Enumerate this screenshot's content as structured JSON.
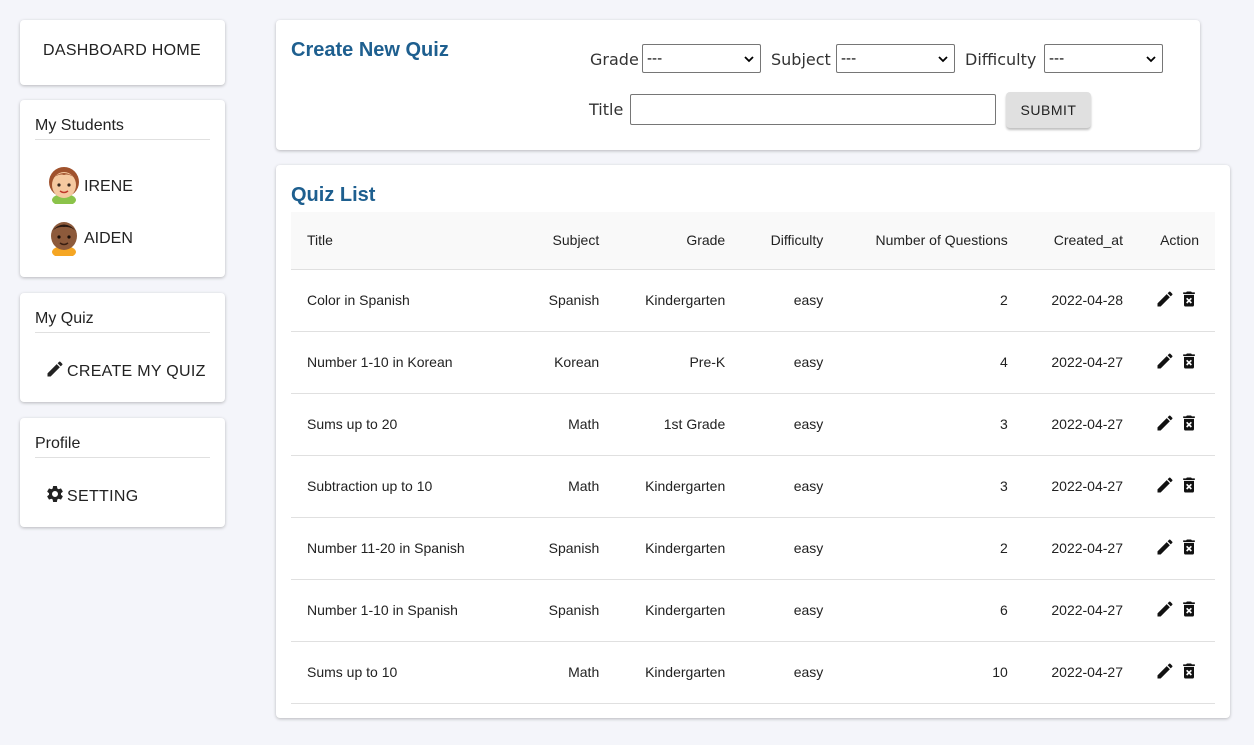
{
  "sidebar": {
    "home_label": "DASHBOARD HOME",
    "students": {
      "heading": "My Students",
      "items": [
        {
          "name": "IRENE",
          "avatar": "girl-avatar"
        },
        {
          "name": "AIDEN",
          "avatar": "boy-avatar"
        }
      ]
    },
    "quiz": {
      "heading": "My Quiz",
      "create_label": "CREATE MY QUIZ",
      "icon": "pencil-icon"
    },
    "profile": {
      "heading": "Profile",
      "setting_label": "SETTING",
      "icon": "gear-icon"
    }
  },
  "create_quiz": {
    "title": "Create New Quiz",
    "grade_label": "Grade",
    "grade_value": "---",
    "subject_label": "Subject",
    "subject_value": "---",
    "difficulty_label": "Difficulty",
    "difficulty_value": "---",
    "title_label": "Title",
    "title_value": "",
    "submit_label": "SUBMIT"
  },
  "quiz_list": {
    "title": "Quiz List",
    "columns": [
      "Title",
      "Subject",
      "Grade",
      "Difficulty",
      "Number of Questions",
      "Created_at",
      "Action"
    ],
    "rows": [
      {
        "title": "Color in Spanish",
        "subject": "Spanish",
        "grade": "Kindergarten",
        "difficulty": "easy",
        "questions": "2",
        "created": "2022-04-28"
      },
      {
        "title": "Number 1-10 in Korean",
        "subject": "Korean",
        "grade": "Pre-K",
        "difficulty": "easy",
        "questions": "4",
        "created": "2022-04-27"
      },
      {
        "title": "Sums up to 20",
        "subject": "Math",
        "grade": "1st Grade",
        "difficulty": "easy",
        "questions": "3",
        "created": "2022-04-27"
      },
      {
        "title": "Subtraction up to 10",
        "subject": "Math",
        "grade": "Kindergarten",
        "difficulty": "easy",
        "questions": "3",
        "created": "2022-04-27"
      },
      {
        "title": "Number 11-20 in Spanish",
        "subject": "Spanish",
        "grade": "Kindergarten",
        "difficulty": "easy",
        "questions": "2",
        "created": "2022-04-27"
      },
      {
        "title": "Number 1-10 in Spanish",
        "subject": "Spanish",
        "grade": "Kindergarten",
        "difficulty": "easy",
        "questions": "6",
        "created": "2022-04-27"
      },
      {
        "title": "Sums up to 10",
        "subject": "Math",
        "grade": "Kindergarten",
        "difficulty": "easy",
        "questions": "10",
        "created": "2022-04-27"
      }
    ]
  },
  "colors": {
    "accent": "#1e5f8f",
    "background": "#f4f5fa"
  }
}
